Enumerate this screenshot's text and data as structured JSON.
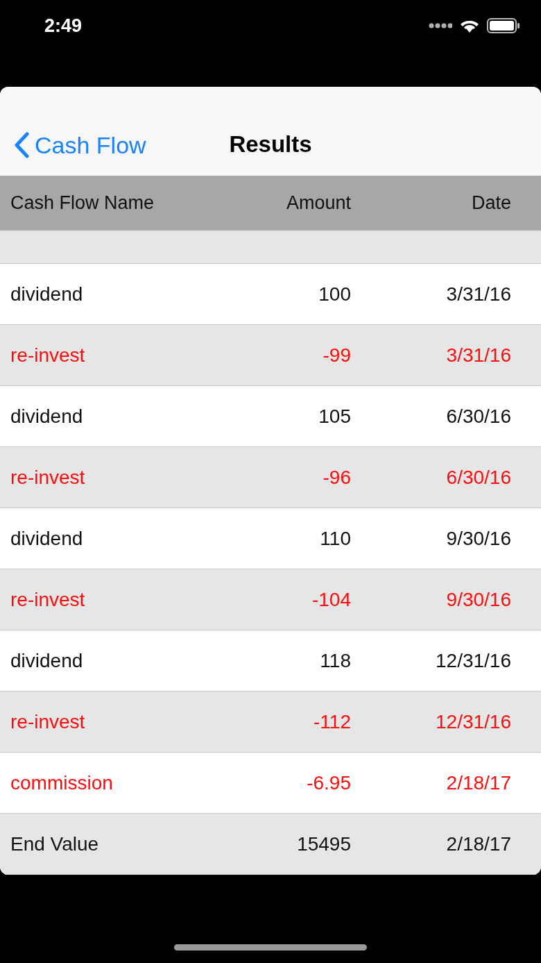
{
  "status_bar": {
    "time": "2:49"
  },
  "nav": {
    "back": "Cash Flow",
    "title": "Results"
  },
  "table": {
    "columns": [
      "Cash Flow Name",
      "Amount",
      "Date"
    ],
    "rows": [
      {
        "kind": "inflow",
        "name": "dividend",
        "amount": "100",
        "date": "3/31/16"
      },
      {
        "kind": "outflow",
        "name": "re-invest",
        "amount": "-99",
        "date": "3/31/16"
      },
      {
        "kind": "inflow",
        "name": "dividend",
        "amount": "105",
        "date": "6/30/16"
      },
      {
        "kind": "outflow",
        "name": "re-invest",
        "amount": "-96",
        "date": "6/30/16"
      },
      {
        "kind": "inflow",
        "name": "dividend",
        "amount": "110",
        "date": "9/30/16"
      },
      {
        "kind": "outflow",
        "name": "re-invest",
        "amount": "-104",
        "date": "9/30/16"
      },
      {
        "kind": "inflow",
        "name": "dividend",
        "amount": "118",
        "date": "12/31/16"
      },
      {
        "kind": "outflow",
        "name": "re-invest",
        "amount": "-112",
        "date": "12/31/16"
      },
      {
        "kind": "outflow",
        "name": "commission",
        "amount": "-6.95",
        "date": "2/18/17"
      },
      {
        "kind": "total",
        "name": "End Value",
        "amount": "15495",
        "date": "2/18/17"
      }
    ]
  }
}
